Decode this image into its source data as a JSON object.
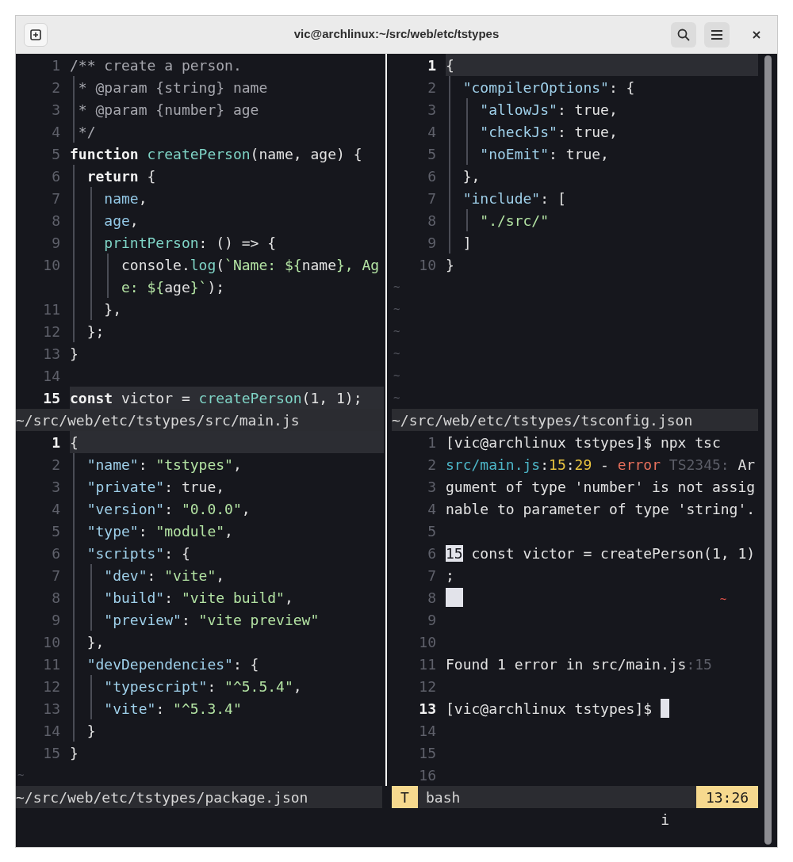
{
  "window": {
    "title": "vic@archlinux:~/src/web/etc/tstypes"
  },
  "rows": [
    {
      "panes": [
        {
          "kind": "editor",
          "lines": [
            {
              "number": "1",
              "current": false,
              "tokens": [
                {
                  "kind": "comment",
                  "text": "/** create a person."
                }
              ]
            },
            {
              "number": "2",
              "current": false,
              "tokens": [
                {
                  "kind": "comment",
                  "text": " * @param {string} name"
                }
              ]
            },
            {
              "number": "3",
              "current": false,
              "tokens": [
                {
                  "kind": "comment",
                  "text": " * @param {number} age"
                }
              ]
            },
            {
              "number": "4",
              "current": false,
              "tokens": [
                {
                  "kind": "comment",
                  "text": " */"
                }
              ]
            },
            {
              "number": "5",
              "current": false,
              "tokens": [
                {
                  "kind": "keyword",
                  "text": "function"
                },
                {
                  "kind": "function",
                  "text": " createPerson"
                },
                {
                  "kind": "plain",
                  "text": "(name, age) {"
                }
              ]
            },
            {
              "number": "6",
              "current": false,
              "tokens": [
                {
                  "kind": "keyword",
                  "text": "  return"
                },
                {
                  "kind": "plain",
                  "text": " {"
                }
              ]
            },
            {
              "number": "7",
              "current": false,
              "tokens": [
                {
                  "kind": "variable",
                  "text": "    name"
                },
                {
                  "kind": "plain",
                  "text": ","
                }
              ]
            },
            {
              "number": "8",
              "current": false,
              "tokens": [
                {
                  "kind": "variable",
                  "text": "    age"
                },
                {
                  "kind": "plain",
                  "text": ","
                }
              ]
            },
            {
              "number": "9",
              "current": false,
              "tokens": [
                {
                  "kind": "function",
                  "text": "    printPerson"
                },
                {
                  "kind": "plain",
                  "text": ": () => {"
                }
              ]
            },
            {
              "number": "10",
              "current": false,
              "tokens": [
                {
                  "kind": "plain",
                  "text": "      console."
                },
                {
                  "kind": "function",
                  "text": "log"
                },
                {
                  "kind": "plain",
                  "text": "("
                },
                {
                  "kind": "string",
                  "text": "`Name: ${"
                },
                {
                  "kind": "plain",
                  "text": "name"
                },
                {
                  "kind": "string",
                  "text": "}, Ag"
                }
              ],
              "continuation": [
                {
                  "kind": "string",
                  "text": "      e: ${"
                },
                {
                  "kind": "plain",
                  "text": "age"
                },
                {
                  "kind": "string",
                  "text": "}`"
                },
                {
                  "kind": "plain",
                  "text": ");"
                }
              ]
            },
            {
              "number": "11",
              "current": false,
              "tokens": [
                {
                  "kind": "plain",
                  "text": "    },"
                }
              ]
            },
            {
              "number": "12",
              "current": false,
              "tokens": [
                {
                  "kind": "plain",
                  "text": "  };"
                }
              ]
            },
            {
              "number": "13",
              "current": false,
              "tokens": [
                {
                  "kind": "plain",
                  "text": "}"
                }
              ]
            },
            {
              "number": "14",
              "current": false
            },
            {
              "number": "15",
              "current": true,
              "tokens": [
                {
                  "kind": "keyword",
                  "text": "const"
                },
                {
                  "kind": "plain",
                  "text": " victor = "
                },
                {
                  "kind": "function",
                  "text": "createPerson"
                },
                {
                  "kind": "plain",
                  "text": "(1, 1);"
                }
              ]
            }
          ],
          "status": {
            "path": "~/src/web/etc/tstypes/src/main.js"
          }
        },
        {
          "kind": "editor",
          "lines": [
            {
              "number": "1",
              "current": true,
              "tokens": [
                {
                  "kind": "plain",
                  "text": "{"
                }
              ]
            },
            {
              "number": "2",
              "current": false,
              "tokens": [
                {
                  "kind": "property",
                  "text": "  \"compilerOptions\""
                },
                {
                  "kind": "plain",
                  "text": ": {"
                }
              ]
            },
            {
              "number": "3",
              "current": false,
              "tokens": [
                {
                  "kind": "property",
                  "text": "    \"allowJs\""
                },
                {
                  "kind": "plain",
                  "text": ": true,"
                }
              ]
            },
            {
              "number": "4",
              "current": false,
              "tokens": [
                {
                  "kind": "property",
                  "text": "    \"checkJs\""
                },
                {
                  "kind": "plain",
                  "text": ": true,"
                }
              ]
            },
            {
              "number": "5",
              "current": false,
              "tokens": [
                {
                  "kind": "property",
                  "text": "    \"noEmit\""
                },
                {
                  "kind": "plain",
                  "text": ": true,"
                }
              ]
            },
            {
              "number": "6",
              "current": false,
              "tokens": [
                {
                  "kind": "plain",
                  "text": "  },"
                }
              ]
            },
            {
              "number": "7",
              "current": false,
              "tokens": [
                {
                  "kind": "property",
                  "text": "  \"include\""
                },
                {
                  "kind": "plain",
                  "text": ": ["
                }
              ]
            },
            {
              "number": "8",
              "current": false,
              "tokens": [
                {
                  "kind": "string",
                  "text": "    \"./src/\""
                }
              ]
            },
            {
              "number": "9",
              "current": false,
              "tokens": [
                {
                  "kind": "plain",
                  "text": "  ]"
                }
              ]
            },
            {
              "number": "10",
              "current": false,
              "tokens": [
                {
                  "kind": "plain",
                  "text": "}"
                }
              ]
            }
          ],
          "filler": [
            "~",
            "~",
            "~",
            "~",
            "~",
            "~"
          ],
          "status": {
            "path": "~/src/web/etc/tstypes/tsconfig.json"
          }
        }
      ]
    },
    {
      "panes": [
        {
          "kind": "editor",
          "lines": [
            {
              "number": "1",
              "current": true,
              "tokens": [
                {
                  "kind": "plain",
                  "text": "{"
                }
              ]
            },
            {
              "number": "2",
              "current": false,
              "tokens": [
                {
                  "kind": "property",
                  "text": "  \"name\""
                },
                {
                  "kind": "plain",
                  "text": ": "
                },
                {
                  "kind": "string",
                  "text": "\"tstypes\""
                },
                {
                  "kind": "plain",
                  "text": ","
                }
              ]
            },
            {
              "number": "3",
              "current": false,
              "tokens": [
                {
                  "kind": "property",
                  "text": "  \"private\""
                },
                {
                  "kind": "plain",
                  "text": ": true,"
                }
              ]
            },
            {
              "number": "4",
              "current": false,
              "tokens": [
                {
                  "kind": "property",
                  "text": "  \"version\""
                },
                {
                  "kind": "plain",
                  "text": ": "
                },
                {
                  "kind": "string",
                  "text": "\"0.0.0\""
                },
                {
                  "kind": "plain",
                  "text": ","
                }
              ]
            },
            {
              "number": "5",
              "current": false,
              "tokens": [
                {
                  "kind": "property",
                  "text": "  \"type\""
                },
                {
                  "kind": "plain",
                  "text": ": "
                },
                {
                  "kind": "string",
                  "text": "\"module\""
                },
                {
                  "kind": "plain",
                  "text": ","
                }
              ]
            },
            {
              "number": "6",
              "current": false,
              "tokens": [
                {
                  "kind": "property",
                  "text": "  \"scripts\""
                },
                {
                  "kind": "plain",
                  "text": ": {"
                }
              ]
            },
            {
              "number": "7",
              "current": false,
              "tokens": [
                {
                  "kind": "property",
                  "text": "    \"dev\""
                },
                {
                  "kind": "plain",
                  "text": ": "
                },
                {
                  "kind": "string",
                  "text": "\"vite\""
                },
                {
                  "kind": "plain",
                  "text": ","
                }
              ]
            },
            {
              "number": "8",
              "current": false,
              "tokens": [
                {
                  "kind": "property",
                  "text": "    \"build\""
                },
                {
                  "kind": "plain",
                  "text": ": "
                },
                {
                  "kind": "string",
                  "text": "\"vite build\""
                },
                {
                  "kind": "plain",
                  "text": ","
                }
              ]
            },
            {
              "number": "9",
              "current": false,
              "tokens": [
                {
                  "kind": "property",
                  "text": "    \"preview\""
                },
                {
                  "kind": "plain",
                  "text": ": "
                },
                {
                  "kind": "string",
                  "text": "\"vite preview\""
                }
              ]
            },
            {
              "number": "10",
              "current": false,
              "tokens": [
                {
                  "kind": "plain",
                  "text": "  },"
                }
              ]
            },
            {
              "number": "11",
              "current": false,
              "tokens": [
                {
                  "kind": "property",
                  "text": "  \"devDependencies\""
                },
                {
                  "kind": "plain",
                  "text": ": {"
                }
              ]
            },
            {
              "number": "12",
              "current": false,
              "tokens": [
                {
                  "kind": "property",
                  "text": "    \"typescript\""
                },
                {
                  "kind": "plain",
                  "text": ": "
                },
                {
                  "kind": "string",
                  "text": "\"^5.5.4\""
                },
                {
                  "kind": "plain",
                  "text": ","
                }
              ]
            },
            {
              "number": "13",
              "current": false,
              "tokens": [
                {
                  "kind": "property",
                  "text": "    \"vite\""
                },
                {
                  "kind": "plain",
                  "text": ": "
                },
                {
                  "kind": "string",
                  "text": "\"^5.3.4\""
                }
              ]
            },
            {
              "number": "14",
              "current": false,
              "tokens": [
                {
                  "kind": "plain",
                  "text": "  }"
                }
              ]
            },
            {
              "number": "15",
              "current": false,
              "tokens": [
                {
                  "kind": "plain",
                  "text": "}"
                }
              ]
            }
          ],
          "filler": [
            "~"
          ],
          "status": {
            "path": "~/src/web/etc/tstypes/package.json"
          }
        },
        {
          "kind": "terminal",
          "lines": [
            {
              "number": "1",
              "current": false,
              "tokens": [
                {
                  "kind": "plain",
                  "text": "[vic@archlinux tstypes]$ npx tsc"
                }
              ]
            },
            {
              "number": "2",
              "current": false,
              "tokens": [
                {
                  "kind": "path",
                  "text": "src/main.js"
                },
                {
                  "kind": "plain",
                  "text": ":"
                },
                {
                  "kind": "location",
                  "text": "15"
                },
                {
                  "kind": "plain",
                  "text": ":"
                },
                {
                  "kind": "location",
                  "text": "29"
                },
                {
                  "kind": "plain",
                  "text": " - "
                },
                {
                  "kind": "error",
                  "text": "error"
                },
                {
                  "kind": "dim",
                  "text": " TS2345:"
                },
                {
                  "kind": "plain",
                  "text": " Ar"
                }
              ]
            },
            {
              "number": "3",
              "current": false,
              "tokens": [
                {
                  "kind": "plain",
                  "text": "gument of type 'number' is not assig"
                }
              ]
            },
            {
              "number": "4",
              "current": false,
              "tokens": [
                {
                  "kind": "plain",
                  "text": "nable to parameter of type 'string'."
                }
              ]
            },
            {
              "number": "5",
              "current": false
            },
            {
              "number": "6",
              "current": false,
              "tokens": [
                {
                  "kind": "selection",
                  "text": "15"
                },
                {
                  "kind": "plain",
                  "text": " const victor = createPerson(1, 1)"
                }
              ]
            },
            {
              "number": "7",
              "current": false,
              "tokens": [
                {
                  "kind": "plain",
                  "text": ";"
                }
              ]
            },
            {
              "number": "8",
              "current": false,
              "tokens": [
                {
                  "kind": "block"
                },
                {
                  "kind": "squiggle",
                  "text": "~"
                }
              ]
            },
            {
              "number": "9",
              "current": false
            },
            {
              "number": "10",
              "current": false
            },
            {
              "number": "11",
              "current": false,
              "tokens": [
                {
                  "kind": "plain",
                  "text": "Found 1 error in src/main.js"
                },
                {
                  "kind": "dim",
                  "text": ":15"
                }
              ]
            },
            {
              "number": "12",
              "current": false
            },
            {
              "number": "13",
              "current": true,
              "tokens": [
                {
                  "kind": "plain",
                  "text": "[vic@archlinux tstypes]$ "
                },
                {
                  "kind": "cursor"
                }
              ]
            },
            {
              "number": "14",
              "current": false
            },
            {
              "number": "15",
              "current": false
            },
            {
              "number": "16",
              "current": false
            }
          ],
          "status": {
            "tag": "T",
            "title": "bash",
            "clock": "13:26"
          }
        }
      ]
    }
  ],
  "mode_line": "i"
}
